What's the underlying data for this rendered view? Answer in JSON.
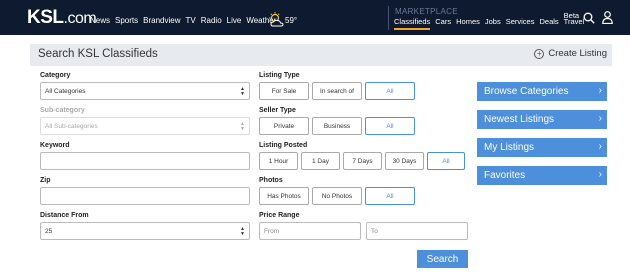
{
  "nav": {
    "logo_main": "KSL",
    "logo_suffix": ".com",
    "links": [
      "News",
      "Sports",
      "Brandview",
      "TV",
      "Radio",
      "Live",
      "Weather"
    ],
    "temperature": "59°",
    "marketplace_label": "MARKETPLACE",
    "right_links": [
      "Classifieds",
      "Cars",
      "Homes",
      "Jobs",
      "Services",
      "Deals"
    ],
    "travel_beta": "Beta",
    "travel_label": "Travel",
    "icons": [
      "weather-partly-cloudy-icon",
      "search-icon",
      "user-icon"
    ]
  },
  "header": {
    "title": "Search KSL Classifieds",
    "create_listing": "Create Listing"
  },
  "form": {
    "category": {
      "label": "Category",
      "value": "All Categories"
    },
    "subcategory": {
      "label": "Sub-category",
      "value": "All Sub-categories"
    },
    "keyword": {
      "label": "Keyword",
      "value": ""
    },
    "zip": {
      "label": "Zip",
      "value": ""
    },
    "distance": {
      "label": "Distance From",
      "value": "25"
    },
    "listing_type": {
      "label": "Listing Type",
      "options": [
        "For Sale",
        "In search of",
        "All"
      ],
      "selected": "All"
    },
    "seller_type": {
      "label": "Seller Type",
      "options": [
        "Private",
        "Business",
        "All"
      ],
      "selected": "All"
    },
    "listing_posted": {
      "label": "Listing Posted",
      "options": [
        "1 Hour",
        "1 Day",
        "7 Days",
        "30 Days",
        "All"
      ],
      "selected": "All"
    },
    "photos": {
      "label": "Photos",
      "options": [
        "Has Photos",
        "No Photos",
        "All"
      ],
      "selected": "All"
    },
    "price_range": {
      "label": "Price Range",
      "from_placeholder": "From",
      "to_placeholder": "To"
    },
    "search_button": "Search"
  },
  "side_buttons": [
    "Browse Categories",
    "Newest Listings",
    "My Listings",
    "Favorites"
  ],
  "colors": {
    "nav_bg": "#0d1a2f",
    "accent_blue": "#4d8fdb",
    "active_underline": "#f5a623",
    "strip_bg": "#e7ebf0"
  }
}
